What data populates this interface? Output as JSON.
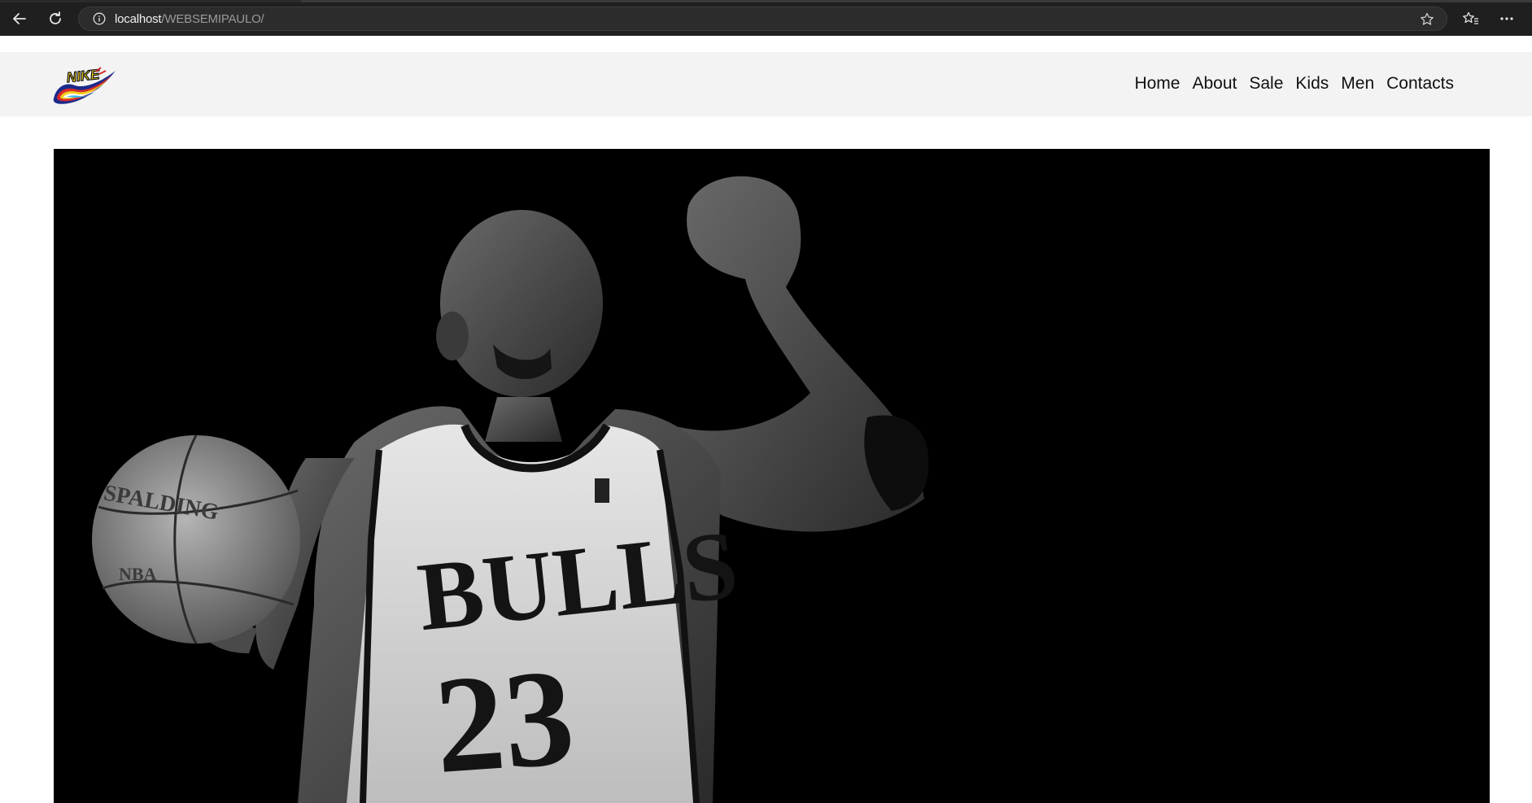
{
  "browser": {
    "url_host": "localhost",
    "url_path": "/WEBSEMIPAULO/",
    "icons": [
      "back-arrow-icon",
      "reload-icon",
      "info-icon",
      "star-icon",
      "favorites-icon",
      "more-icon"
    ]
  },
  "header": {
    "logo_text": "NIKE",
    "nav": [
      "Home",
      "About",
      "Sale",
      "Kids",
      "Men",
      "Contacts"
    ]
  },
  "hero": {
    "jersey_team": "BULLS",
    "jersey_number": "23",
    "ball_brand": "SPALDING",
    "ball_league": "NBA"
  },
  "colors": {
    "browser_bg": "#1f1f1f",
    "header_bg": "#f3f3f3",
    "hero_bg": "#000000",
    "nav_text": "#111111"
  }
}
